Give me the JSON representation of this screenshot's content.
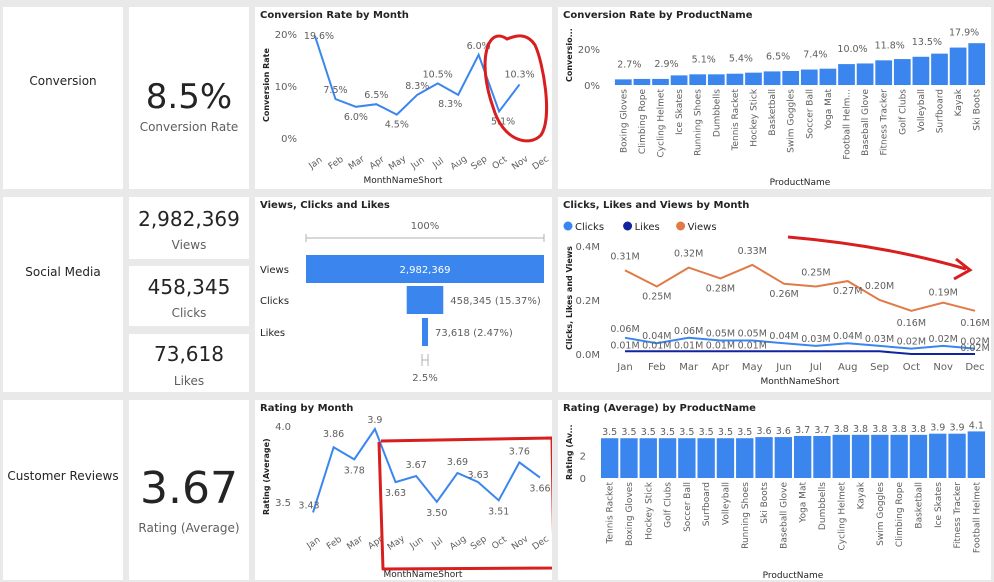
{
  "sections": {
    "conversion": "Conversion",
    "social": "Social Media",
    "reviews": "Customer Reviews"
  },
  "kpis": {
    "conversion_value": "8.5%",
    "conversion_label": "Conversion Rate",
    "views_value": "2,982,369",
    "views_label": "Views",
    "clicks_value": "458,345",
    "clicks_label": "Clicks",
    "likes_value": "73,618",
    "likes_label": "Likes",
    "rating_value": "3.67",
    "rating_label": "Rating (Average)"
  },
  "titles": {
    "conv_month": "Conversion Rate by Month",
    "conv_product": "Conversion Rate by ProductName",
    "funnel": "Views, Clicks and Likes",
    "social_month": "Clicks, Likes and Views by Month",
    "rating_month": "Rating by Month",
    "rating_product": "Rating (Average) by ProductName"
  },
  "colors": {
    "blue": "#3b86ee",
    "dark_blue": "#12239e",
    "orange": "#e07b48",
    "annotation_red": "#d81e1e"
  },
  "months": [
    "Jan",
    "Feb",
    "Mar",
    "Apr",
    "May",
    "Jun",
    "Jul",
    "Aug",
    "Sep",
    "Oct",
    "Nov",
    "Dec"
  ],
  "chart_data": [
    {
      "id": "conv_month",
      "type": "line",
      "xlabel": "MonthNameShort",
      "ylabel": "Conversion Rate",
      "yticks": [
        "20%",
        "10%",
        "0%"
      ],
      "ylim": [
        0,
        20
      ],
      "values": [
        19.6,
        7.5,
        6.0,
        6.5,
        4.5,
        8.3,
        10.5,
        8.3,
        16.0,
        5.1,
        10.3
      ],
      "labels": [
        "19.6%",
        "7.5%",
        "6.0%",
        "6.5%",
        "4.5%",
        "8.3%",
        "10.5%",
        "8.3%",
        "6.0%",
        "5.1%",
        "10.3%"
      ]
    },
    {
      "id": "conv_product",
      "type": "bar",
      "xlabel": "ProductName",
      "ylabel": "Conversio...",
      "yticks": [
        "20%",
        "0%"
      ],
      "ylim": [
        0,
        22
      ],
      "categories": [
        "Boxing Gloves",
        "Climbing Rope",
        "Cycling Helmet",
        "Ice Skates",
        "Running Shoes",
        "Dumbbells",
        "Tennis Racket",
        "Hockey Stick",
        "Basketball",
        "Swim Goggles",
        "Soccer Ball",
        "Yoga Mat",
        "Football Helm...",
        "Baseball Glove",
        "Fitness Tracker",
        "Golf Clubs",
        "Volleyball",
        "Surfboard",
        "Kayak",
        "Ski Boots"
      ],
      "values": [
        2.7,
        2.9,
        2.9,
        4.6,
        5.1,
        5.1,
        5.4,
        5.9,
        6.5,
        6.7,
        7.4,
        7.8,
        10.0,
        10.3,
        11.8,
        12.4,
        13.5,
        15.0,
        17.9,
        20.0
      ],
      "labels": [
        "2.7%",
        "",
        "2.9%",
        "",
        "5.1%",
        "",
        "5.4%",
        "",
        "6.5%",
        "",
        "7.4%",
        "",
        "10.0%",
        "",
        "11.8%",
        "",
        "13.5%",
        "",
        "17.9%",
        ""
      ]
    },
    {
      "id": "funnel",
      "type": "bar",
      "top_label": "100%",
      "bottom_label": "2.5%",
      "categories": [
        "Views",
        "Clicks",
        "Likes"
      ],
      "values": [
        2982369,
        458345,
        73618
      ],
      "labels": [
        "2,982,369",
        "458,345 (15.37%)",
        "73,618 (2.47%)"
      ]
    },
    {
      "id": "social_month",
      "type": "line",
      "xlabel": "MonthNameShort",
      "ylabel": "Clicks, Likes and Views",
      "yticks": [
        "0.4M",
        "0.2M",
        "0.0M"
      ],
      "ylim": [
        0,
        0.4
      ],
      "legend": [
        "Clicks",
        "Likes",
        "Views"
      ],
      "series": [
        {
          "name": "Views",
          "values": [
            0.31,
            0.25,
            0.32,
            0.28,
            0.33,
            0.26,
            0.25,
            0.27,
            0.2,
            0.16,
            0.19,
            0.16
          ],
          "labels": [
            "0.31M",
            "0.25M",
            "0.32M",
            "0.28M",
            "0.33M",
            "0.26M",
            "0.25M",
            "0.27M",
            "0.20M",
            "0.16M",
            "0.19M",
            "0.16M"
          ]
        },
        {
          "name": "Clicks",
          "values": [
            0.06,
            0.04,
            0.06,
            0.05,
            0.05,
            0.04,
            0.03,
            0.04,
            0.03,
            0.02,
            0.03,
            0.02
          ],
          "labels": [
            "0.06M",
            "0.04M",
            "0.06M",
            "0.05M",
            "0.05M",
            "0.04M",
            "0.03M",
            "0.04M",
            "0.03M",
            "0.02M",
            "0.02M",
            "0.02M"
          ]
        },
        {
          "name": "Likes",
          "values": [
            0.01,
            0.01,
            0.01,
            0.01,
            0.01,
            0.01,
            0.01,
            0.01,
            0.01,
            0.0,
            0.0,
            0.0
          ],
          "labels": [
            "0.01M",
            "0.01M",
            "0.01M",
            "0.01M",
            "0.01M",
            "",
            "",
            "",
            "",
            "",
            "",
            "0.02M"
          ]
        }
      ]
    },
    {
      "id": "rating_month",
      "type": "line",
      "xlabel": "MonthNameShort",
      "ylabel": "Rating (Average)",
      "yticks": [
        "4.0",
        "3.5"
      ],
      "ylim": [
        3.4,
        4.0
      ],
      "values": [
        3.43,
        3.86,
        3.78,
        3.98,
        3.63,
        3.67,
        3.5,
        3.69,
        3.63,
        3.51,
        3.76,
        3.66
      ],
      "labels": [
        "3.43",
        "3.86",
        "3.78",
        "3.9",
        "3.63",
        "3.67",
        "3.50",
        "3.69",
        "3.63",
        "3.51",
        "3.76",
        "3.66"
      ]
    },
    {
      "id": "rating_product",
      "type": "bar",
      "xlabel": "ProductName",
      "ylabel": "Rating (Av...",
      "yticks": [
        "2",
        "0"
      ],
      "ylim": [
        0,
        4.4
      ],
      "categories": [
        "Tennis Racket",
        "Boxing Gloves",
        "Hockey Stick",
        "Golf Clubs",
        "Soccer Ball",
        "Surfboard",
        "Volleyball",
        "Running Shoes",
        "Ski Boots",
        "Baseball Glove",
        "Yoga Mat",
        "Dumbbells",
        "Cycling Helmet",
        "Kayak",
        "Swim Goggles",
        "Climbing Rope",
        "Basketball",
        "Ice Skates",
        "Fitness Tracker",
        "Football Helmet"
      ],
      "values": [
        3.5,
        3.5,
        3.5,
        3.5,
        3.5,
        3.5,
        3.5,
        3.5,
        3.6,
        3.6,
        3.7,
        3.7,
        3.8,
        3.8,
        3.8,
        3.8,
        3.8,
        3.9,
        3.9,
        4.1
      ],
      "labels": [
        "3.5",
        "3.5",
        "3.5",
        "3.5",
        "3.5",
        "3.5",
        "3.5",
        "3.5",
        "3.6",
        "3.6",
        "3.7",
        "3.7",
        "3.8",
        "3.8",
        "3.8",
        "3.8",
        "3.8",
        "3.9",
        "3.9",
        "4.1"
      ]
    }
  ]
}
